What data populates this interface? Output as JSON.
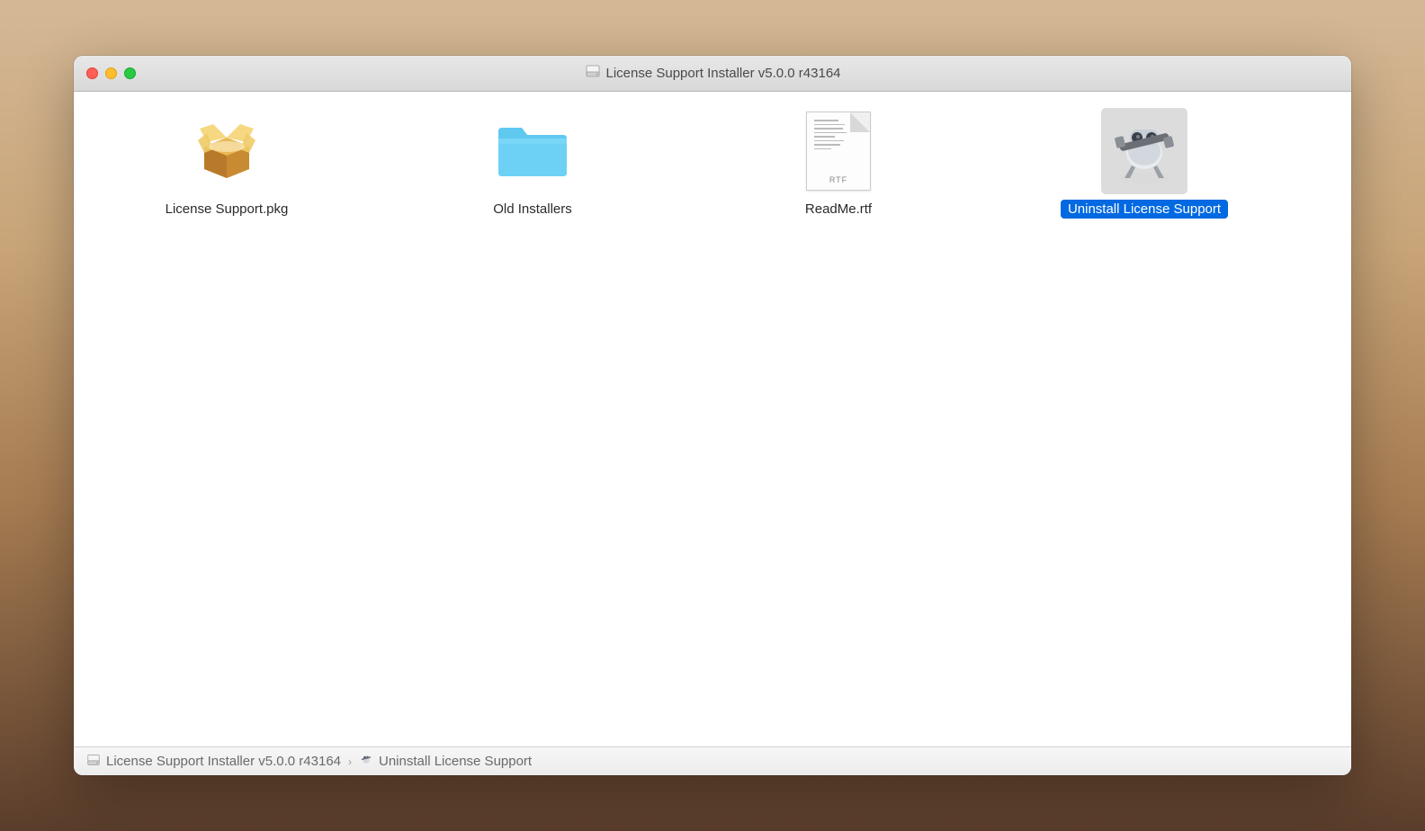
{
  "window": {
    "title": "License Support Installer v5.0.0 r43164"
  },
  "items": [
    {
      "label": "License Support.pkg",
      "icon": "package",
      "selected": false
    },
    {
      "label": "Old Installers",
      "icon": "folder",
      "selected": false
    },
    {
      "label": "ReadMe.rtf",
      "icon": "rtf",
      "rtf_badge": "RTF",
      "selected": false
    },
    {
      "label": "Uninstall License Support",
      "icon": "automator",
      "selected": true
    }
  ],
  "pathbar": {
    "root": "License Support Installer v5.0.0 r43164",
    "current": "Uninstall License Support"
  }
}
